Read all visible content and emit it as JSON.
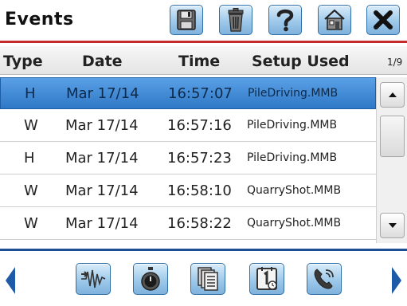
{
  "header": {
    "title": "Events",
    "toolbar": [
      {
        "icon": "save-icon"
      },
      {
        "icon": "trash-icon"
      },
      {
        "icon": "help-icon"
      },
      {
        "icon": "home-icon"
      },
      {
        "icon": "close-icon"
      }
    ]
  },
  "table": {
    "columns": [
      "Type",
      "Date",
      "Time",
      "Setup Used"
    ],
    "page_indicator": "1/9",
    "rows": [
      {
        "type": "H",
        "date": "Mar 17/14",
        "time": "16:57:07",
        "setup": "PileDriving.MMB",
        "selected": true
      },
      {
        "type": "W",
        "date": "Mar 17/14",
        "time": "16:57:16",
        "setup": "PileDriving.MMB",
        "selected": false
      },
      {
        "type": "H",
        "date": "Mar 17/14",
        "time": "16:57:23",
        "setup": "PileDriving.MMB",
        "selected": false
      },
      {
        "type": "W",
        "date": "Mar 17/14",
        "time": "16:58:10",
        "setup": "QuarryShot.MMB",
        "selected": false
      },
      {
        "type": "W",
        "date": "Mar 17/14",
        "time": "16:58:22",
        "setup": "QuarryShot.MMB",
        "selected": false
      }
    ]
  },
  "footer": {
    "buttons": [
      {
        "icon": "waveform-icon"
      },
      {
        "icon": "timer-icon"
      },
      {
        "icon": "documents-icon"
      },
      {
        "icon": "calendar-icon"
      },
      {
        "icon": "phone-icon"
      }
    ]
  },
  "colors": {
    "accent_red": "#c62a2a",
    "accent_blue": "#1e4f95",
    "selection": "#3a86d4"
  }
}
